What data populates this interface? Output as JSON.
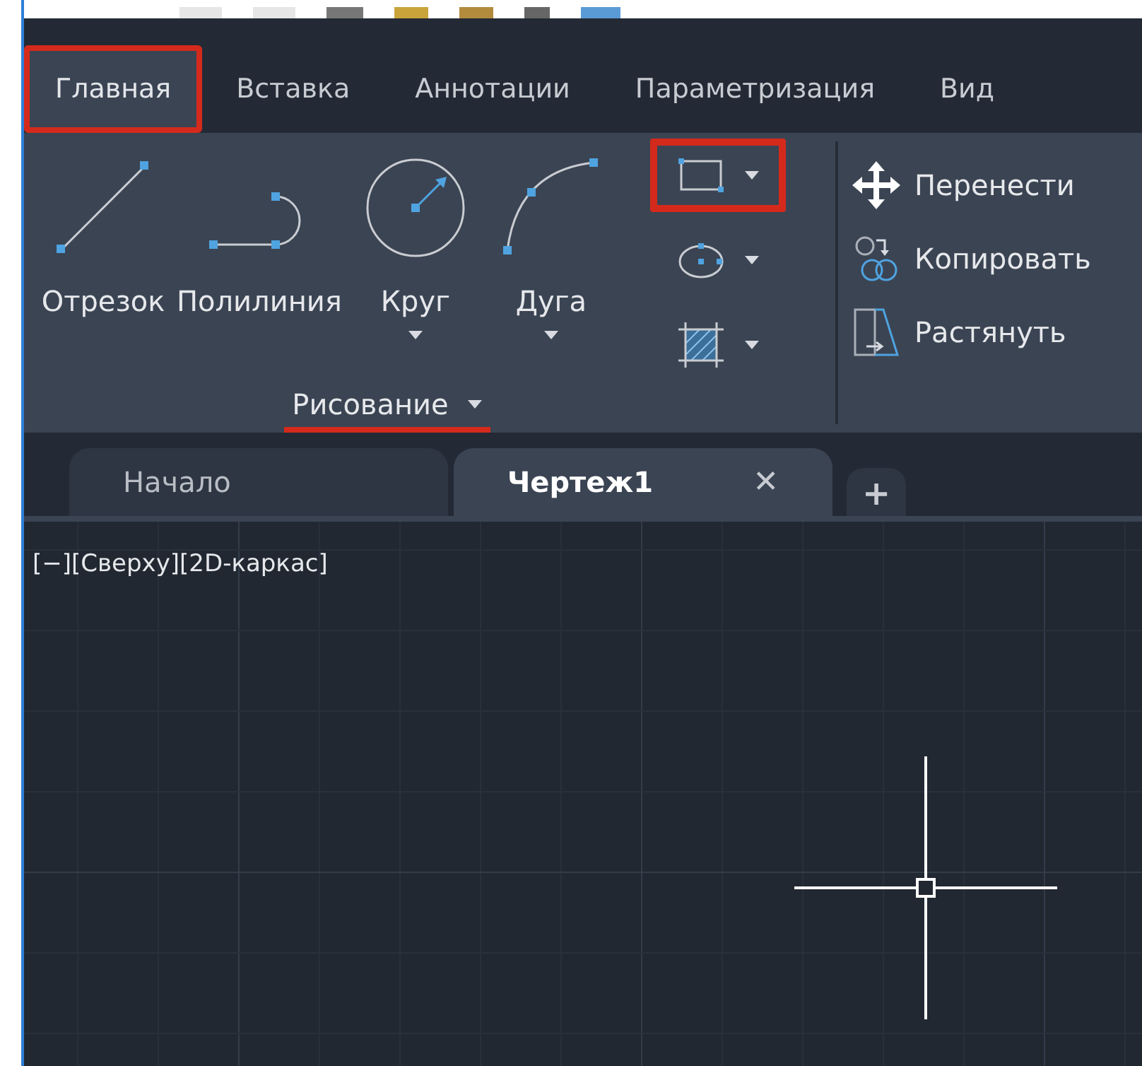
{
  "ribbon_tabs": [
    {
      "label": "Главная",
      "selected": true,
      "highlighted": true
    },
    {
      "label": "Вставка",
      "selected": false,
      "highlighted": false
    },
    {
      "label": "Аннотации",
      "selected": false,
      "highlighted": false
    },
    {
      "label": "Параметризация",
      "selected": false,
      "highlighted": false
    },
    {
      "label": "Вид",
      "selected": false,
      "highlighted": false
    }
  ],
  "draw_panel": {
    "title": "Рисование",
    "title_underlined": true,
    "large_tools": [
      {
        "label": "Отрезок",
        "kind": "line",
        "dropdown": false
      },
      {
        "label": "Полилиния",
        "kind": "polyline",
        "dropdown": false
      },
      {
        "label": "Круг",
        "kind": "circle",
        "dropdown": true
      },
      {
        "label": "Дуга",
        "kind": "arc",
        "dropdown": true
      }
    ],
    "small_tools": [
      {
        "kind": "rectangle",
        "highlighted": true
      },
      {
        "kind": "ellipse",
        "highlighted": false
      },
      {
        "kind": "hatch",
        "highlighted": false
      }
    ]
  },
  "modify_panel": {
    "tools": [
      {
        "label": "Перенести",
        "kind": "move"
      },
      {
        "label": "Копировать",
        "kind": "copy"
      },
      {
        "label": "Растянуть",
        "kind": "stretch"
      }
    ]
  },
  "doc_tabs": [
    {
      "label": "Начало",
      "selected": false,
      "closable": false
    },
    {
      "label": "Чертеж1",
      "selected": true,
      "closable": true
    }
  ],
  "new_tab": "+",
  "close_glyph": "✕",
  "viewport_label": "[−][Сверху][2D-каркас]"
}
